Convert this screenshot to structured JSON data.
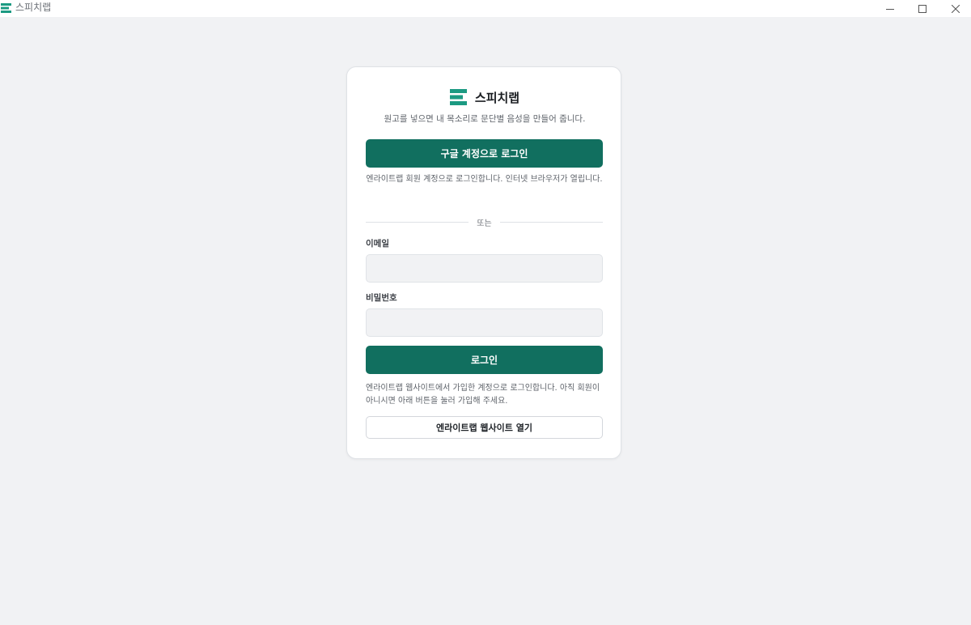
{
  "window": {
    "title": "스피치랩",
    "icon": "app-logo-icon"
  },
  "colors": {
    "accent": "#116f5f",
    "logo": "#1c9a82",
    "background": "#f1f2f4"
  },
  "brand": {
    "name": "스피치랩",
    "subtitle": "원고를 넣으면 내 목소리로 문단별 음성을 만들어 줍니다."
  },
  "google_login": {
    "button_label": "구글 계정으로 로그인",
    "note": "엔라이트랩 회원 계정으로 로그인합니다. 인터넷 브라우저가 열립니다."
  },
  "divider_label": "또는",
  "form": {
    "email_label": "이메일",
    "email_value": "",
    "password_label": "비밀번호",
    "password_value": "",
    "login_button_label": "로그인",
    "login_note": "엔라이트랩 웹사이트에서 가입한 계정으로 로그인합니다. 아직 회원이 아니시면 아래 버튼을 눌러 가입해 주세요."
  },
  "website_button_label": "엔라이트랩 웹사이트 열기"
}
